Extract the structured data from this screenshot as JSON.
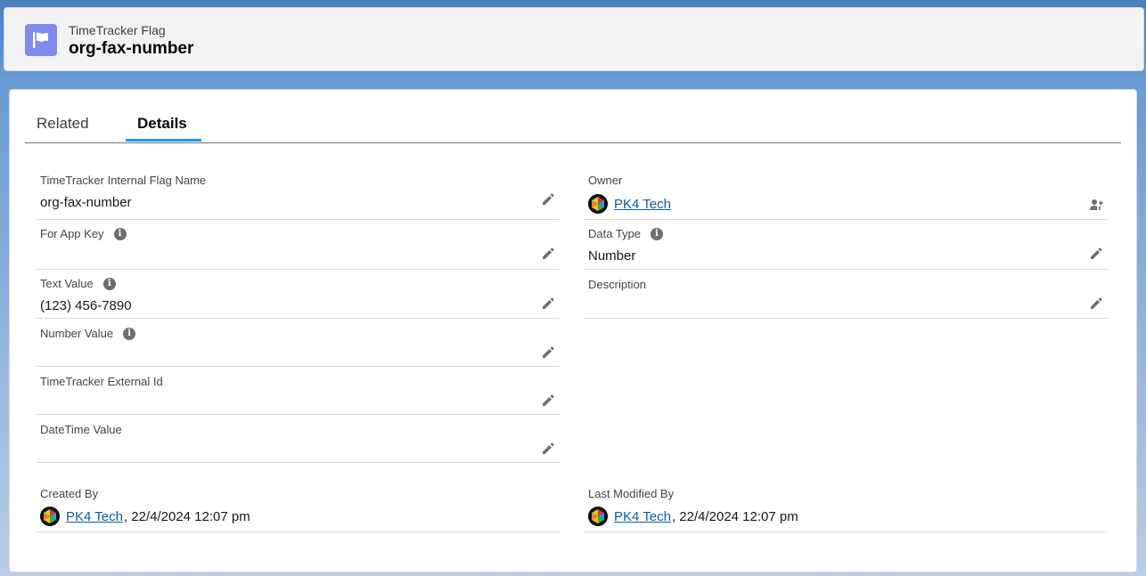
{
  "header": {
    "object_type": "TimeTracker Flag",
    "record_name": "org-fax-number"
  },
  "tabs": [
    {
      "label": "Related",
      "active": false
    },
    {
      "label": "Details",
      "active": true
    }
  ],
  "fields": {
    "internal_flag_name": {
      "label": "TimeTracker Internal Flag Name",
      "value": "org-fax-number"
    },
    "for_app_key": {
      "label": "For App Key",
      "value": ""
    },
    "text_value": {
      "label": "Text Value",
      "value": "(123) 456-7890"
    },
    "number_value": {
      "label": "Number Value",
      "value": ""
    },
    "external_id": {
      "label": "TimeTracker External Id",
      "value": ""
    },
    "datetime_value": {
      "label": "DateTime Value",
      "value": ""
    },
    "owner": {
      "label": "Owner",
      "value": "PK4 Tech"
    },
    "data_type": {
      "label": "Data Type",
      "value": "Number"
    },
    "description": {
      "label": "Description",
      "value": ""
    },
    "created_by": {
      "label": "Created By",
      "user": "PK4 Tech",
      "timestamp": ", 22/4/2024 12:07 pm"
    },
    "last_modified_by": {
      "label": "Last Modified By",
      "user": "PK4 Tech",
      "timestamp": ", 22/4/2024 12:07 pm"
    }
  },
  "info_glyph": "i",
  "colors": {
    "accent": "#1b96ff",
    "link": "#0b5cab",
    "icon_bg": "#7f8ced"
  },
  "icons": {
    "header": "flag-icon",
    "edit": "pencil-icon",
    "info": "info-icon",
    "owner_change": "change-owner-icon",
    "avatar": "user-avatar"
  }
}
